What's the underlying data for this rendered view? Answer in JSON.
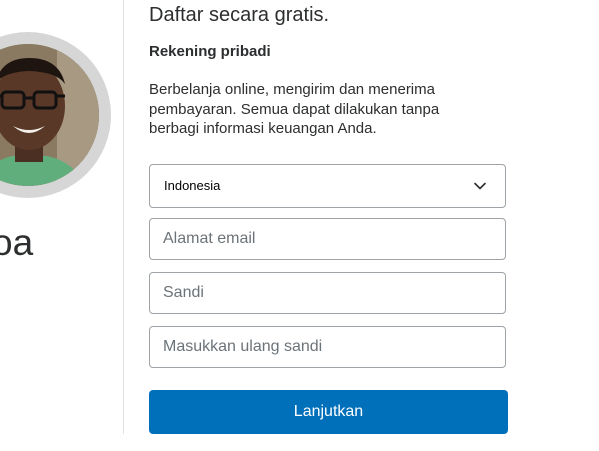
{
  "left_panel": {
    "name_fragment": "oa"
  },
  "form": {
    "heading": "Daftar secara gratis.",
    "subheading": "Rekening pribadi",
    "description": "Berbelanja online, mengirim dan menerima pembayaran. Semua dapat dilakukan tanpa berbagi informasi keuangan Anda.",
    "country": {
      "selected": "Indonesia",
      "icon": "chevron-down-icon"
    },
    "email": {
      "placeholder": "Alamat email",
      "value": ""
    },
    "password": {
      "placeholder": "Sandi",
      "value": ""
    },
    "confirm_password": {
      "placeholder": "Masukkan ulang sandi",
      "value": ""
    },
    "submit_label": "Lanjutkan"
  },
  "colors": {
    "primary_button": "#0070ba",
    "field_border": "#9da3a6",
    "text": "#2c2e2f",
    "avatar_ring": "#d6d6d6"
  }
}
